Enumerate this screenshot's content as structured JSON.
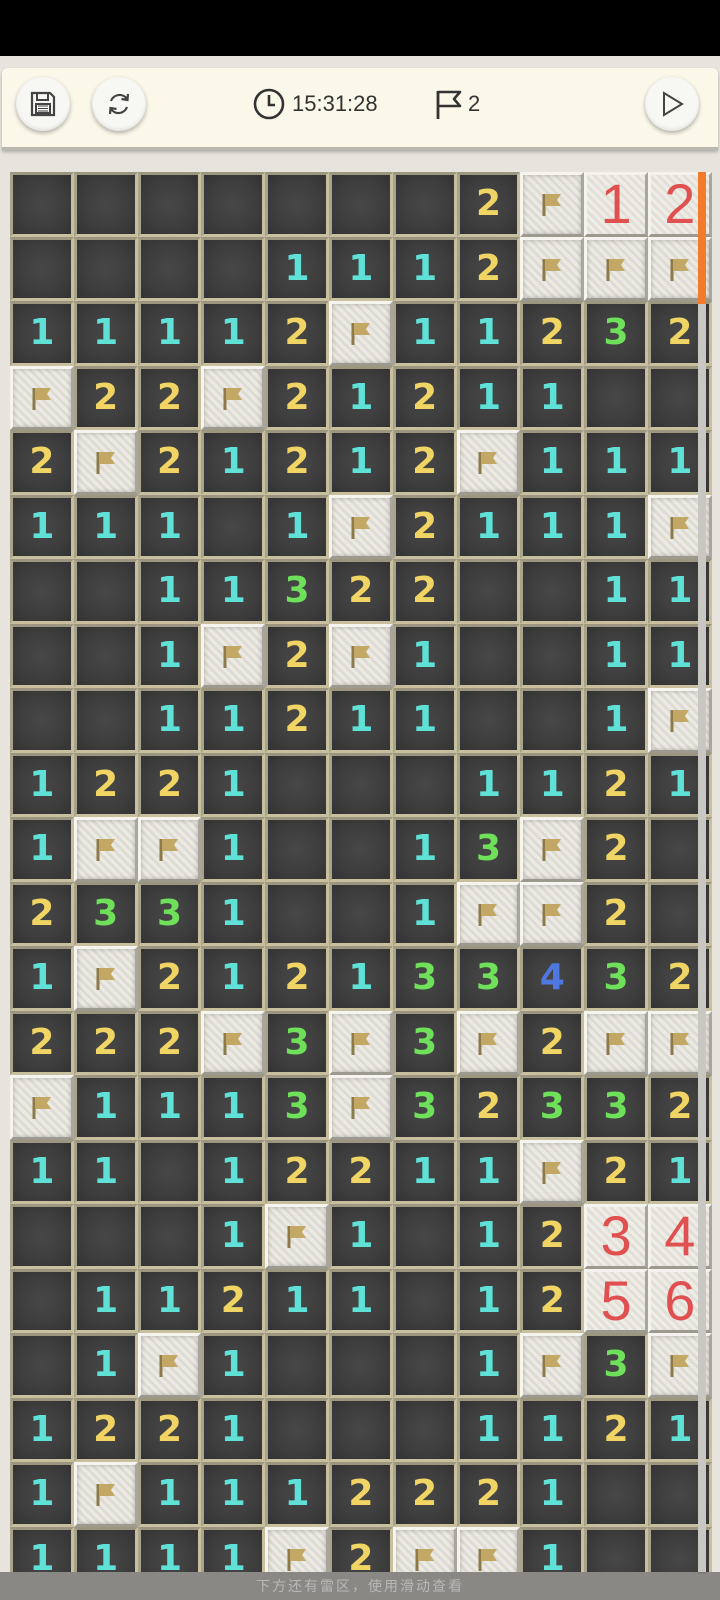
{
  "toolbar": {
    "timer": "15:31:28",
    "flags_placed": "2",
    "icons": {
      "save": "save-icon",
      "restart": "restart-icon",
      "clock": "clock-icon",
      "flag": "flag-icon",
      "play": "play-icon"
    }
  },
  "board": {
    "columns": 11,
    "rows": [
      [
        "",
        "",
        "",
        "",
        "",
        "",
        "",
        "2",
        "F",
        "h1",
        "h2"
      ],
      [
        "",
        "",
        "",
        "",
        "1",
        "1",
        "1",
        "2",
        "F",
        "F",
        "F"
      ],
      [
        "1",
        "1",
        "1",
        "1",
        "2",
        "F",
        "1",
        "1",
        "2",
        "3",
        "2"
      ],
      [
        "F",
        "2",
        "2",
        "F",
        "2",
        "1",
        "2",
        "1",
        "1",
        "",
        ""
      ],
      [
        "2",
        "F",
        "2",
        "1",
        "2",
        "1",
        "2",
        "F",
        "1",
        "1",
        "1"
      ],
      [
        "1",
        "1",
        "1",
        "",
        "1",
        "F",
        "2",
        "1",
        "1",
        "1",
        "F"
      ],
      [
        "",
        "",
        "1",
        "1",
        "3",
        "2",
        "2",
        "",
        "",
        "1",
        "1"
      ],
      [
        "",
        "",
        "1",
        "F",
        "2",
        "F",
        "1",
        "",
        "",
        "1",
        "1"
      ],
      [
        "",
        "",
        "1",
        "1",
        "2",
        "1",
        "1",
        "",
        "",
        "1",
        "F"
      ],
      [
        "1",
        "2",
        "2",
        "1",
        "",
        "",
        "",
        "1",
        "1",
        "2",
        "1"
      ],
      [
        "1",
        "F",
        "F",
        "1",
        "",
        "",
        "1",
        "3",
        "F",
        "2",
        ""
      ],
      [
        "2",
        "3",
        "3",
        "1",
        "",
        "",
        "1",
        "F",
        "F",
        "2",
        ""
      ],
      [
        "1",
        "F",
        "2",
        "1",
        "2",
        "1",
        "3",
        "3",
        "4",
        "3",
        "2"
      ],
      [
        "2",
        "2",
        "2",
        "F",
        "3",
        "F",
        "3",
        "F",
        "2",
        "F",
        "F"
      ],
      [
        "F",
        "1",
        "1",
        "1",
        "3",
        "F",
        "3",
        "2",
        "3",
        "3",
        "2"
      ],
      [
        "1",
        "1",
        "",
        "1",
        "2",
        "2",
        "1",
        "1",
        "F",
        "2",
        "1"
      ],
      [
        "",
        "",
        "",
        "1",
        "F",
        "1",
        "",
        "1",
        "2",
        "h3",
        "h4"
      ],
      [
        "",
        "1",
        "1",
        "2",
        "1",
        "1",
        "",
        "1",
        "2",
        "h5",
        "h6"
      ],
      [
        "",
        "1",
        "F",
        "1",
        "",
        "",
        "",
        "1",
        "F",
        "3",
        "F"
      ],
      [
        "1",
        "2",
        "2",
        "1",
        "",
        "",
        "",
        "1",
        "1",
        "2",
        "1"
      ],
      [
        "1",
        "F",
        "1",
        "1",
        "1",
        "2",
        "2",
        "2",
        "1",
        "",
        ""
      ],
      [
        "1",
        "1",
        "1",
        "1",
        "F",
        "2",
        "F",
        "F",
        "1",
        "",
        ""
      ]
    ]
  },
  "footer": {
    "hint": "下方还有雷区，使用滑动查看"
  },
  "colors": {
    "n1": "#5fe1d8",
    "n2": "#f0d564",
    "n3": "#6fe05a",
    "n4": "#4e78e0",
    "hint_digit": "#e15050",
    "scroll_accent": "#f47a2c"
  }
}
